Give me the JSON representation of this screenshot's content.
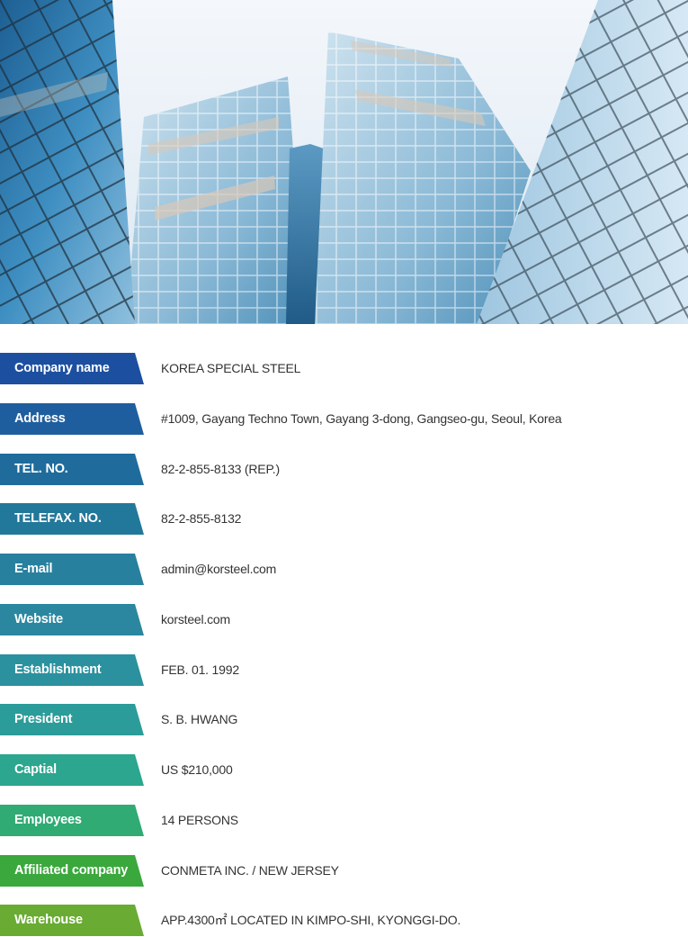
{
  "company_info": [
    {
      "label": "Company name",
      "value": "KOREA SPECIAL STEEL",
      "color": "#1c4fa0"
    },
    {
      "label": "Address",
      "value": "#1009, Gayang Techno Town, Gayang 3-dong, Gangseo-gu, Seoul, Korea",
      "color": "#1f5e9e"
    },
    {
      "label": "TEL. NO.",
      "value": "82-2-855-8133 (REP.)",
      "color": "#1f6c9c"
    },
    {
      "label": "TELEFAX. NO.",
      "value": "82-2-855-8132",
      "color": "#22789a"
    },
    {
      "label": "E-mail",
      "value": "admin@korsteel.com",
      "color": "#27809e"
    },
    {
      "label": "Website",
      "value": "korsteel.com",
      "color": "#2a879f"
    },
    {
      "label": "Establishment",
      "value": "FEB. 01. 1992",
      "color": "#2b919e"
    },
    {
      "label": "President",
      "value": "S. B. HWANG",
      "color": "#2b9c9a"
    },
    {
      "label": "Captial",
      "value": "US $210,000",
      "color": "#2ca68e"
    },
    {
      "label": "Employees",
      "value": "14 PERSONS",
      "color": "#2fab73"
    },
    {
      "label": "Affiliated company",
      "value": "CONMETA INC. / NEW JERSEY",
      "color": "#3aa83c"
    },
    {
      "label": "Warehouse",
      "value": "APP.4300㎡ LOCATED IN KIMPO-SHI, KYONGGI-DO.",
      "color": "#6aab33"
    }
  ]
}
